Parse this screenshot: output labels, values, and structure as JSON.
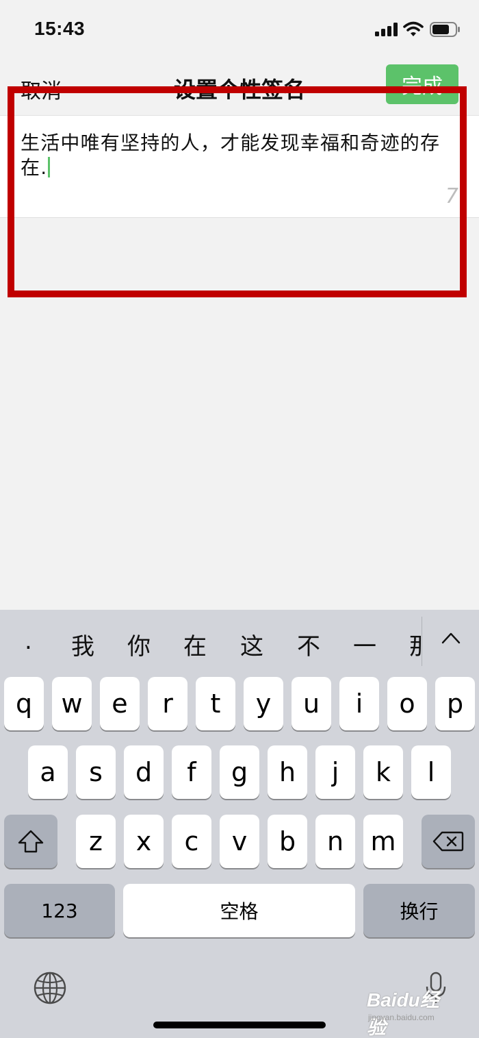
{
  "status_bar": {
    "time": "15:43"
  },
  "nav": {
    "cancel_label": "取消",
    "title": "设置个性签名",
    "done_label": "完成"
  },
  "signature": {
    "text": "生活中唯有坚持的人，才能发现幸福和奇迹的存在.",
    "remaining": "7"
  },
  "keyboard": {
    "candidates": [
      ".",
      "我",
      "你",
      "在",
      "这",
      "不",
      "一",
      "那"
    ],
    "row1": [
      "q",
      "w",
      "e",
      "r",
      "t",
      "y",
      "u",
      "i",
      "o",
      "p"
    ],
    "row2": [
      "a",
      "s",
      "d",
      "f",
      "g",
      "h",
      "j",
      "k",
      "l"
    ],
    "row3": [
      "z",
      "x",
      "c",
      "v",
      "b",
      "n",
      "m"
    ],
    "numbers_label": "123",
    "space_label": "空格",
    "return_label": "换行"
  },
  "watermark": {
    "brand": "Baidu经验",
    "url": "jingyan.baidu.com"
  },
  "colors": {
    "accent_green": "#5cc26a",
    "highlight_red": "#c00000",
    "keyboard_bg": "#d2d4da"
  },
  "icons": [
    "signal-icon",
    "wifi-icon",
    "battery-icon",
    "chevron-up-icon",
    "shift-icon",
    "backspace-icon",
    "globe-icon",
    "microphone-icon"
  ]
}
